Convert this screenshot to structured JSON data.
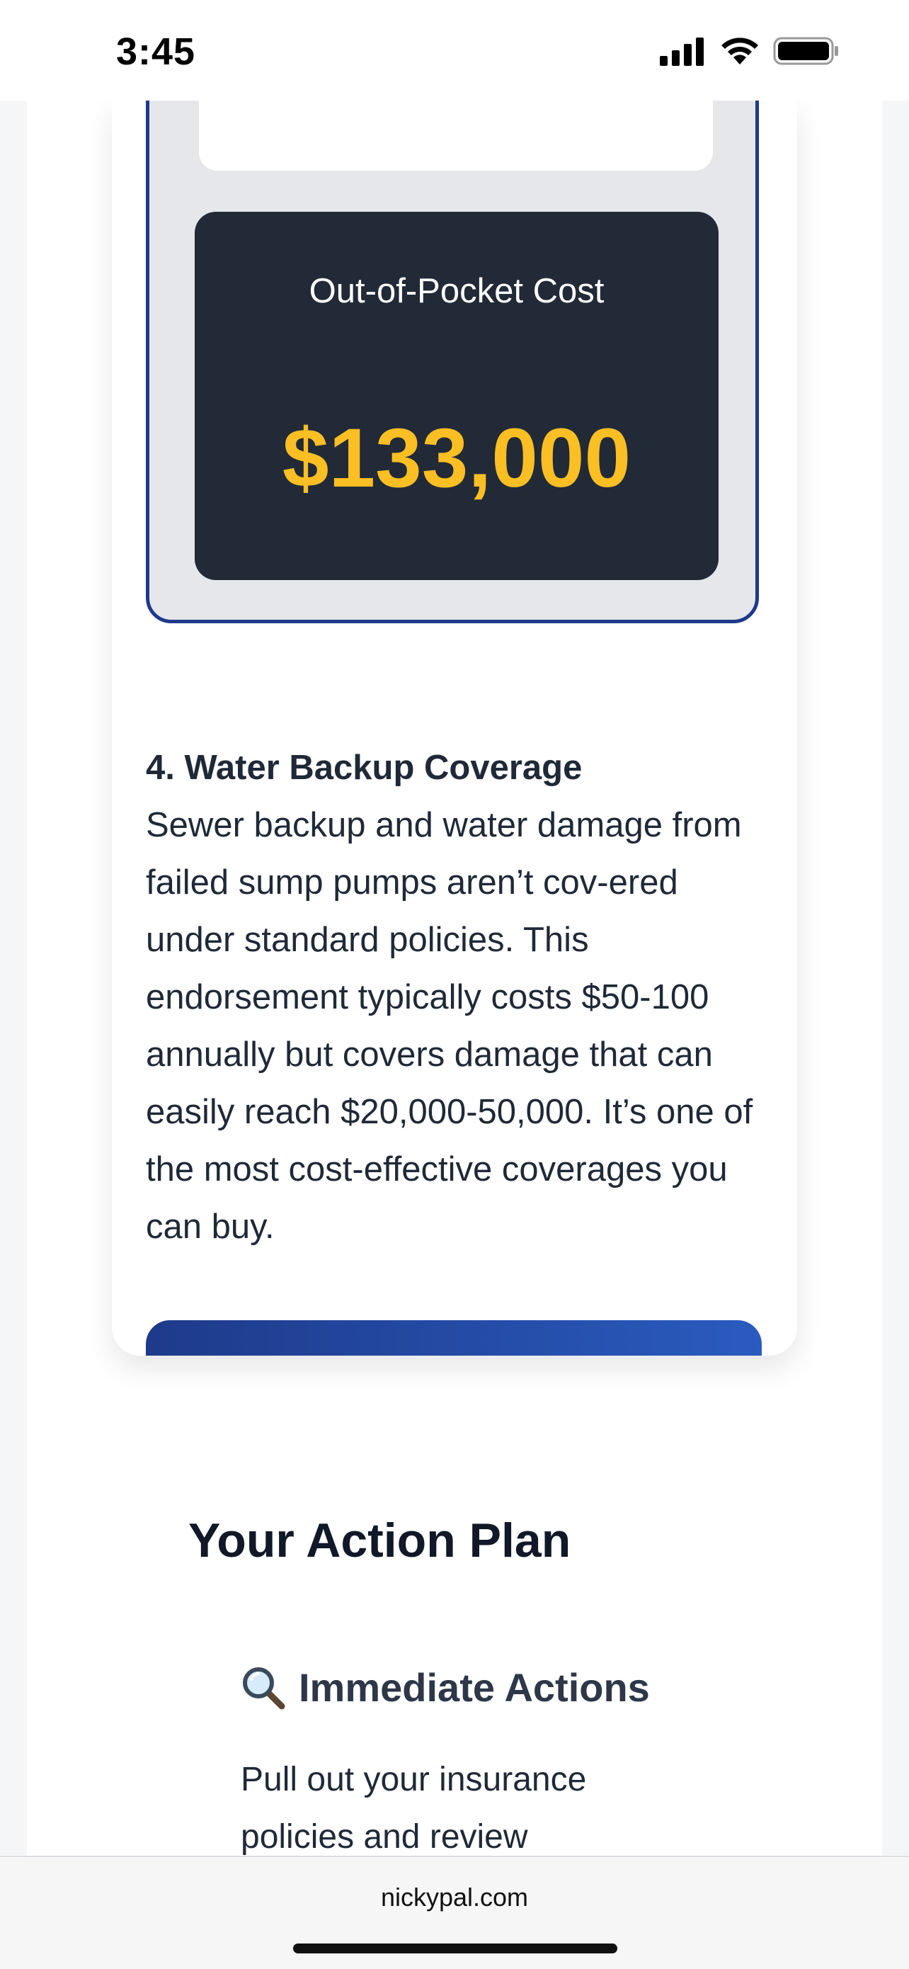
{
  "status_bar": {
    "time": "3:45"
  },
  "scenario": {
    "partial_text": ",  ,",
    "cost_label": "Out-of-Pocket Cost",
    "cost_value": "$133,000"
  },
  "section4": {
    "heading": "4. Water Backup Coverage",
    "body": "Sewer backup and water damage from failed sump pumps aren’t cov-ered under standard policies. This endorsement typically costs $50-100 annually but covers damage that can easily reach $20,000-50,000. It’s one of the most cost-effective coverages you can buy."
  },
  "action_plan": {
    "title": "Your Action Plan",
    "immediate_heading": "Immediate Actions",
    "immediate_icon": "magnifying-glass-icon",
    "immediate_text": "Pull out your insurance policies and review"
  },
  "browser": {
    "url": "nickypal.com"
  },
  "colors": {
    "accent_navy": "#1e3a8a",
    "cost_bg": "#222a38",
    "cost_value": "#fbbf24"
  }
}
